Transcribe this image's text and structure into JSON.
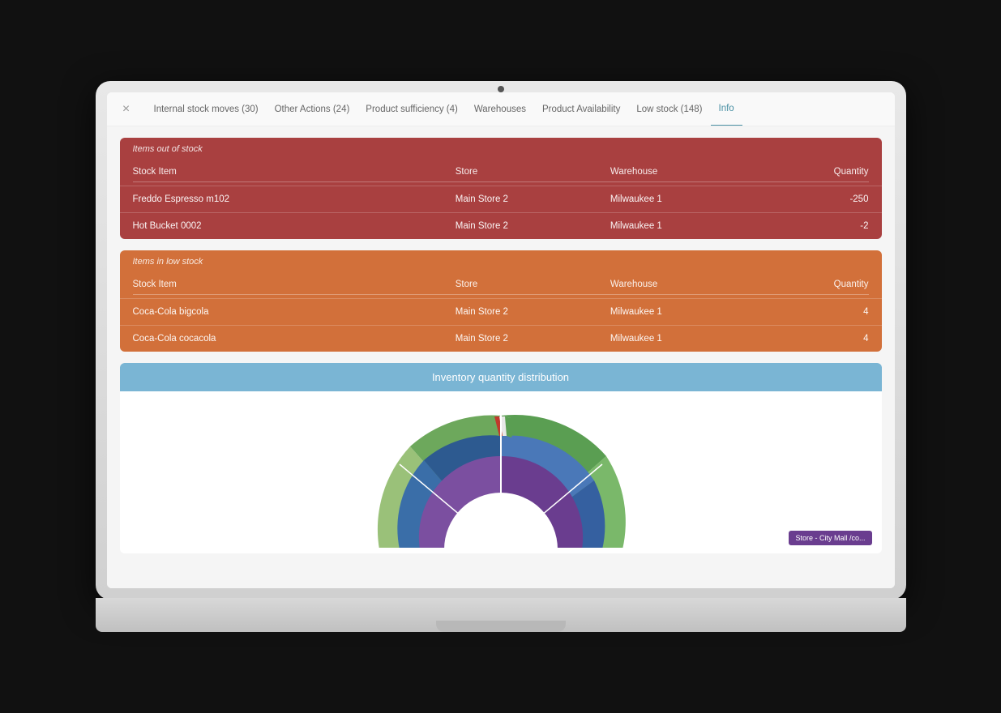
{
  "nav": {
    "close_icon": "×",
    "items": [
      {
        "label": "Internal stock moves (30)",
        "active": false
      },
      {
        "label": "Other Actions (24)",
        "active": false
      },
      {
        "label": "Product sufficiency (4)",
        "active": false
      },
      {
        "label": "Warehouses",
        "active": false
      },
      {
        "label": "Product Availability",
        "active": false
      },
      {
        "label": "Low stock (148)",
        "active": false
      },
      {
        "label": "Info",
        "active": true
      }
    ]
  },
  "out_of_stock": {
    "title": "Items out of stock",
    "headers": [
      "Stock Item",
      "Store",
      "Warehouse",
      "Quantity"
    ],
    "rows": [
      {
        "stock_item": "Freddo Espresso m102",
        "store": "Main Store 2",
        "warehouse": "Milwaukee 1",
        "quantity": "-250"
      },
      {
        "stock_item": "Hot Bucket 0002",
        "store": "Main Store 2",
        "warehouse": "Milwaukee 1",
        "quantity": "-2"
      }
    ]
  },
  "low_stock": {
    "title": "Items in low stock",
    "headers": [
      "Stock Item",
      "Store",
      "Warehouse",
      "Quantity"
    ],
    "rows": [
      {
        "stock_item": "Coca-Cola bigcola",
        "store": "Main Store 2",
        "warehouse": "Milwaukee 1",
        "quantity": "4"
      },
      {
        "stock_item": "Coca-Cola cocacola",
        "store": "Main Store 2",
        "warehouse": "Milwaukee 1",
        "quantity": "4"
      }
    ]
  },
  "chart": {
    "title": "Inventory quantity distribution",
    "tooltip": "Store - City Mall /co..."
  },
  "colors": {
    "out_of_stock_bg": "#a94040",
    "low_stock_bg": "#d2703a",
    "chart_header": "#7ab5d4",
    "nav_active": "#4a90a4"
  }
}
